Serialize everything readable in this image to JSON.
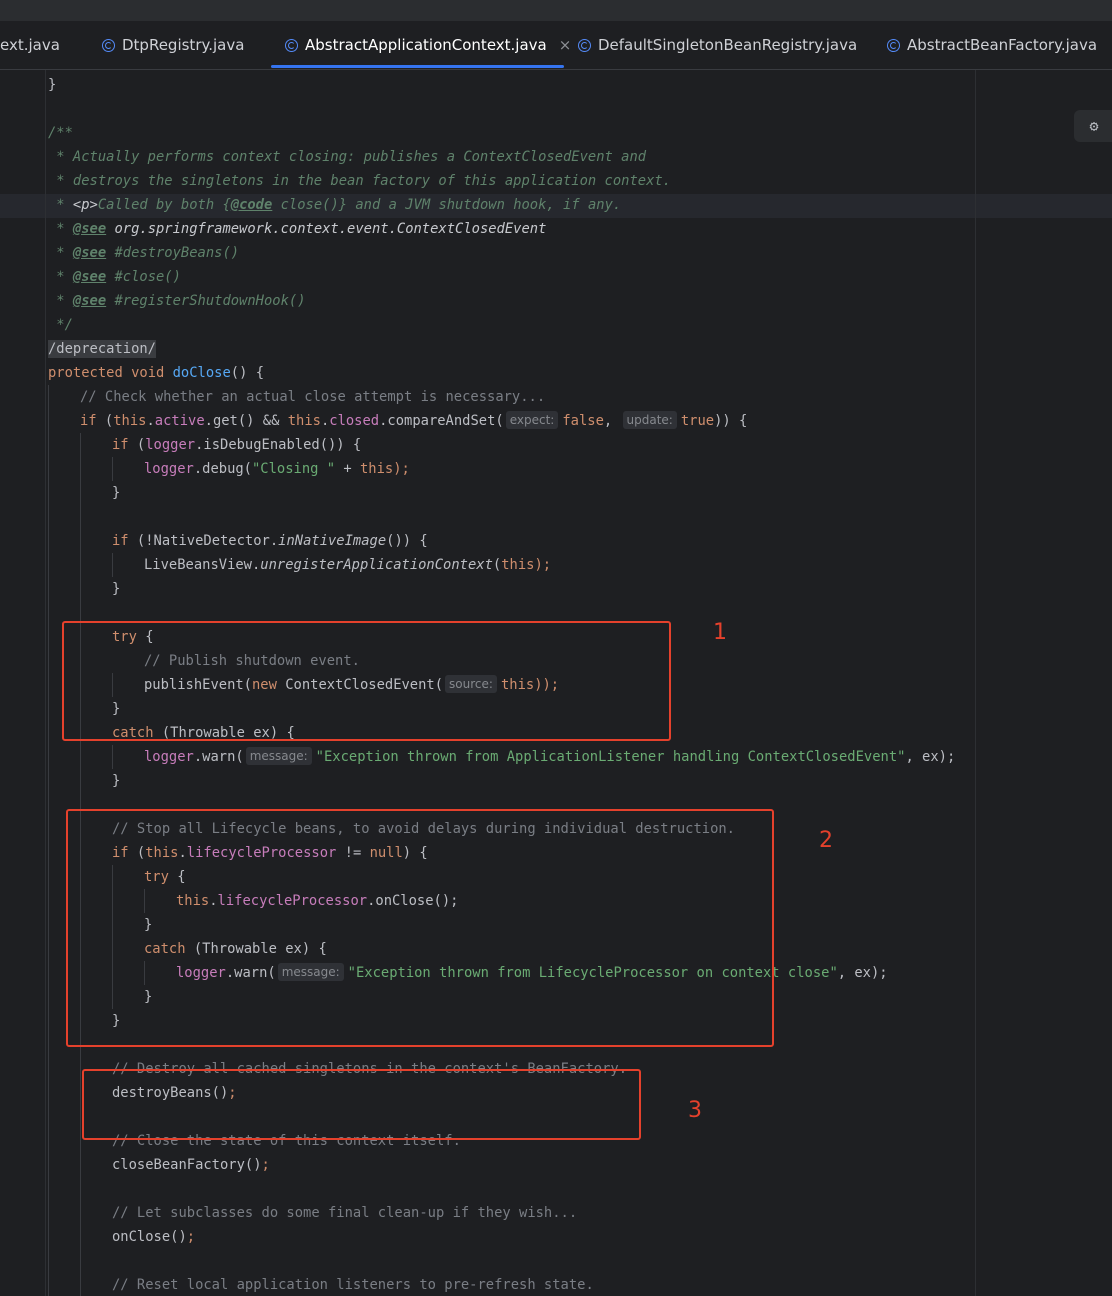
{
  "tabs": [
    {
      "label": "ext.java",
      "icon": "class-icon",
      "active": false
    },
    {
      "label": "DtpRegistry.java",
      "icon": "class-icon",
      "active": false
    },
    {
      "label": "AbstractApplicationContext.java",
      "icon": "class-icon",
      "active": true,
      "close": "×"
    },
    {
      "label": "DefaultSingletonBeanRegistry.java",
      "icon": "class-icon",
      "active": false
    },
    {
      "label": "AbstractBeanFactory.java",
      "icon": "class-icon",
      "active": false
    }
  ],
  "colors": {
    "accent": "#3574f0",
    "annotation_box": "#e5412c",
    "keyword": "#cf8e6d",
    "string": "#6aab73",
    "comment": "#7a7e85",
    "javadoc": "#5f826b",
    "field": "#c77dbb",
    "method": "#56a8f5"
  },
  "code": {
    "l1": "}",
    "l3": "/**",
    "l4a": " * Actually performs context closing: publishes a ContextClosedEvent and",
    "l5a": " * destroys the singletons in the bean factory of this application context.",
    "l6a": " * ",
    "l6b": "<p>",
    "l6c": "Called by both ",
    "l6d": "{",
    "l6e": "@code",
    "l6f": " close()} and a JVM shutdown hook, if any.",
    "l7a": " * ",
    "l7b": "@see",
    "l7c": " org.springframework.context.event.ContextClosedEvent",
    "l8a": " * ",
    "l8b": "@see",
    "l8c": " #destroyBeans()",
    "l9a": " * ",
    "l9b": "@see",
    "l9c": " #close()",
    "l10a": " * ",
    "l10b": "@see",
    "l10c": " #registerShutdownHook()",
    "l11": " */",
    "l12": "/deprecation/",
    "l13a": "protected",
    "l13b": "void",
    "l13c": "doClose",
    "l13d": "() {",
    "l14": "// Check whether an actual close attempt is necessary...",
    "l15a": "if",
    "l15b": " (",
    "l15c": "this",
    "l15d": ".",
    "l15e": "active",
    "l15f": ".get() && ",
    "l15g": "this",
    "l15h": ".",
    "l15i": "closed",
    "l15j": ".compareAndSet(",
    "l15k": "expect:",
    "l15l": "false",
    "l15m": ",",
    "l15n": "update:",
    "l15o": "true",
    "l15p": ")) {",
    "l16a": "if",
    "l16b": " (",
    "l16c": "logger",
    "l16d": ".isDebugEnabled()) {",
    "l17a": "logger",
    "l17b": ".debug(",
    "l17c": "\"Closing \"",
    "l17d": " + ",
    "l17e": "this",
    "l17f": ");",
    "l18": "}",
    "l20a": "if",
    "l20b": " (!NativeDetector.",
    "l20c": "inNativeImage",
    "l20d": "()) {",
    "l21a": "LiveBeansView.",
    "l21b": "unregisterApplicationContext",
    "l21c": "(",
    "l21d": "this",
    "l21e": ");",
    "l22": "}",
    "l24a": "try",
    "l24b": " {",
    "l25": "// Publish shutdown event.",
    "l26a": "publishEvent(",
    "l26b": "new",
    "l26c": " ContextClosedEvent(",
    "l26d": "source:",
    "l26e": "this",
    "l26f": "));",
    "l27": "}",
    "l28a": "catch",
    "l28b": " (Throwable ex) {",
    "l29a": "logger",
    "l29b": ".warn(",
    "l29c": "message:",
    "l29d": "\"Exception thrown from ApplicationListener handling ContextClosedEvent\"",
    "l29e": ", ex);",
    "l30": "}",
    "l32": "// Stop all Lifecycle beans, to avoid delays during individual destruction.",
    "l33a": "if",
    "l33b": " (",
    "l33c": "this",
    "l33d": ".",
    "l33e": "lifecycleProcessor",
    "l33f": " != ",
    "l33g": "null",
    "l33h": ") {",
    "l34a": "try",
    "l34b": " {",
    "l35a": "this",
    "l35b": ".",
    "l35c": "lifecycleProcessor",
    "l35d": ".onClose();",
    "l36": "}",
    "l37a": "catch",
    "l37b": " (Throwable ex) {",
    "l38a": "logger",
    "l38b": ".warn(",
    "l38c": "message:",
    "l38d": "\"Exception thrown from LifecycleProcessor on context close\"",
    "l38e": ", ex);",
    "l39": "}",
    "l40": "}",
    "l42": "// Destroy all cached singletons in the context's BeanFactory.",
    "l43a": "destroyBeans()",
    "l43b": ";",
    "l45": "// Close the state of this context itself.",
    "l46a": "closeBeanFactory()",
    "l46b": ";",
    "l48": "// Let subclasses do some final clean-up if they wish...",
    "l49a": "onClose()",
    "l49b": ";",
    "l51": "// Reset local application listeners to pre-refresh state."
  },
  "annotations": {
    "box1_label": "1",
    "box2_label": "2",
    "box3_label": "3"
  }
}
